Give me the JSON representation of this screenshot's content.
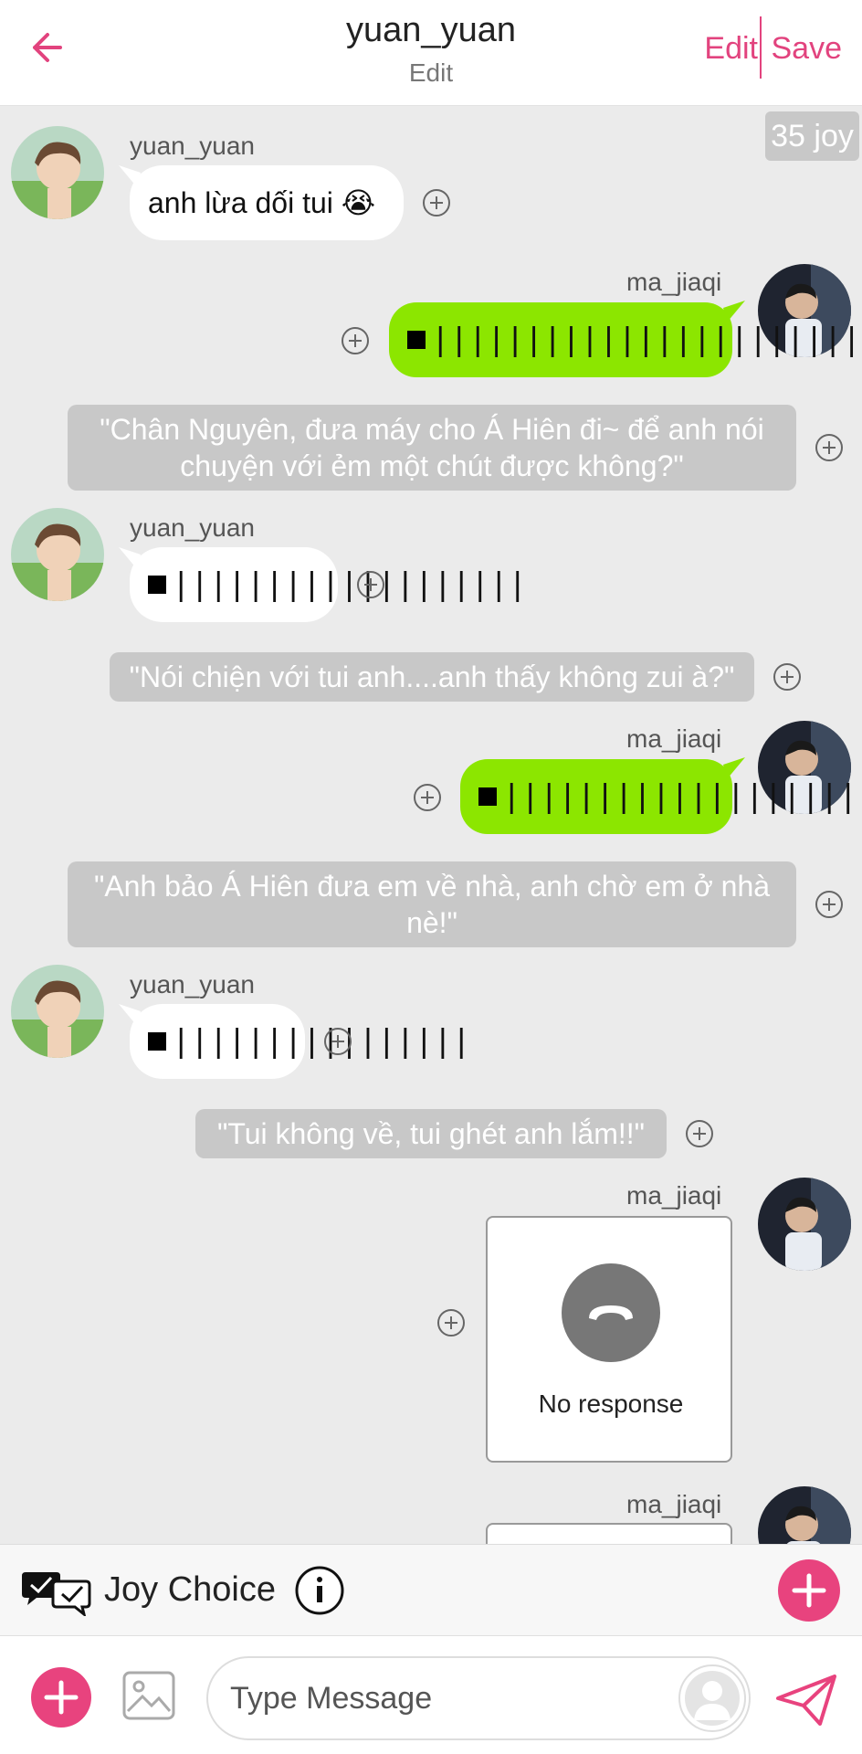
{
  "header": {
    "title": "yuan_yuan",
    "subtitle": "Edit",
    "edit_label": "Edit",
    "save_label": "Save",
    "back_icon": "back-arrow-icon",
    "accent": "#e2437e"
  },
  "badge": {
    "text": "35 joy"
  },
  "messages": [
    {
      "sender": "yuan_yuan",
      "side": "left",
      "type": "text",
      "text": "anh lừa dối tui 😭"
    },
    {
      "sender": "ma_jiaqi",
      "side": "right",
      "type": "voice",
      "bars": "||||||||||||||||||||||||||||"
    },
    {
      "type": "narration",
      "text": "\"Chân Nguyên, đưa máy cho Á Hiên đi~ để anh nói chuyện với ẻm một chút được không?\""
    },
    {
      "sender": "yuan_yuan",
      "side": "left",
      "type": "voice",
      "bars": "|||||||||||||||||||"
    },
    {
      "type": "narration",
      "text": "\"Nói chiện với tui anh....anh thấy không zui à?\""
    },
    {
      "sender": "ma_jiaqi",
      "side": "right",
      "type": "voice",
      "bars": "|||||||||||||||||||||||"
    },
    {
      "type": "narration",
      "text": "\"Anh bảo Á Hiên đưa em về nhà, anh chờ em ở nhà nè!\""
    },
    {
      "sender": "yuan_yuan",
      "side": "left",
      "type": "voice",
      "bars": "||||||||||||||||"
    },
    {
      "type": "narration",
      "text": "\"Tui không về, tui ghét anh lắm!!\""
    },
    {
      "sender": "ma_jiaqi",
      "side": "right",
      "type": "call",
      "text": "No response"
    },
    {
      "sender": "ma_jiaqi",
      "side": "right",
      "type": "call",
      "text": ""
    }
  ],
  "colors": {
    "green_bubble": "#8ce600",
    "narration_bg": "#c8c8c8",
    "chat_bg": "#ebebeb"
  },
  "joy_choice": {
    "label": "Joy Choice"
  },
  "composer": {
    "placeholder": "Type Message"
  }
}
